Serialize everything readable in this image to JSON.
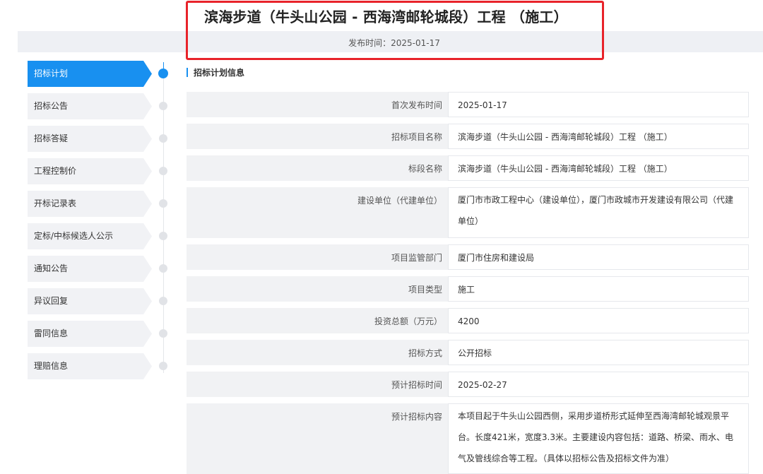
{
  "header": {
    "title": "滨海步道（牛头山公园 - 西海湾邮轮城段）工程 （施工）",
    "publish_label": "发布时间：",
    "publish_date": "2025-01-17"
  },
  "nav": {
    "items": [
      {
        "label": "招标计划",
        "active": true
      },
      {
        "label": "招标公告",
        "active": false
      },
      {
        "label": "招标答疑",
        "active": false
      },
      {
        "label": "工程控制价",
        "active": false
      },
      {
        "label": "开标记录表",
        "active": false
      },
      {
        "label": "定标/中标候选人公示",
        "active": false
      },
      {
        "label": "通知公告",
        "active": false
      },
      {
        "label": "异议回复",
        "active": false
      },
      {
        "label": "雷同信息",
        "active": false
      },
      {
        "label": "理赔信息",
        "active": false
      }
    ]
  },
  "section": {
    "title": "招标计划信息"
  },
  "rows": [
    {
      "label": "首次发布时间",
      "value": "2025-01-17"
    },
    {
      "label": "招标项目名称",
      "value": "滨海步道（牛头山公园 - 西海湾邮轮城段）工程 （施工）"
    },
    {
      "label": "标段名称",
      "value": "滨海步道（牛头山公园 - 西海湾邮轮城段）工程 （施工）"
    },
    {
      "label": "建设单位（代建单位）",
      "value": "厦门市市政工程中心（建设单位），厦门市政城市开发建设有限公司（代建单位）"
    },
    {
      "label": "项目监管部门",
      "value": "厦门市住房和建设局"
    },
    {
      "label": "项目类型",
      "value": "施工"
    },
    {
      "label": "投资总额（万元）",
      "value": "4200"
    },
    {
      "label": "招标方式",
      "value": "公开招标"
    },
    {
      "label": "预计招标时间",
      "value": "2025-02-27"
    },
    {
      "label": "预计招标内容",
      "value": "本项目起于牛头山公园西侧，采用步道桥形式延伸至西海湾邮轮城观景平台。长度421米，宽度3.3米。主要建设内容包括：道路、桥梁、雨水、电气及管线综合等工程。（具体以招标公告及招标文件为准）"
    }
  ]
}
